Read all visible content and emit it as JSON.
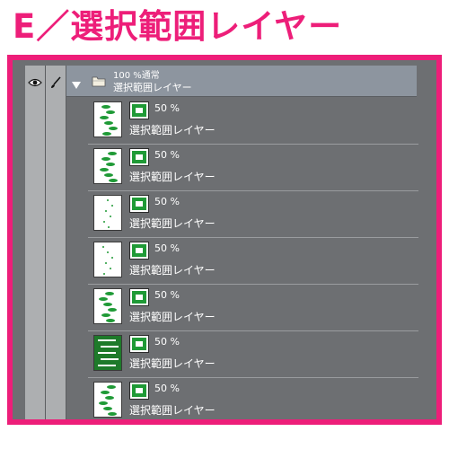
{
  "heading": "E／選択範囲レイヤー",
  "palette": {
    "frame": "#ed1e79",
    "panel": "#6d6f72",
    "folder": "#8d959f",
    "green": "#1f9a36"
  },
  "columns": {
    "visibility_icon": "eye-icon",
    "edit_icon": "brush-icon"
  },
  "folder": {
    "expand_icon": "triangle-down-icon",
    "icon": "folder-icon",
    "opacity_blend": "100 %通常",
    "name": "選択範囲レイヤー"
  },
  "layers": [
    {
      "opacity": "50 %",
      "name": "選択範囲レイヤー",
      "thumb": "light"
    },
    {
      "opacity": "50 %",
      "name": "選択範囲レイヤー",
      "thumb": "light"
    },
    {
      "opacity": "50 %",
      "name": "選択範囲レイヤー",
      "thumb": "light"
    },
    {
      "opacity": "50 %",
      "name": "選択範囲レイヤー",
      "thumb": "light"
    },
    {
      "opacity": "50 %",
      "name": "選択範囲レイヤー",
      "thumb": "light"
    },
    {
      "opacity": "50 %",
      "name": "選択範囲レイヤー",
      "thumb": "dark"
    },
    {
      "opacity": "50 %",
      "name": "選択範囲レイヤー",
      "thumb": "light"
    }
  ]
}
